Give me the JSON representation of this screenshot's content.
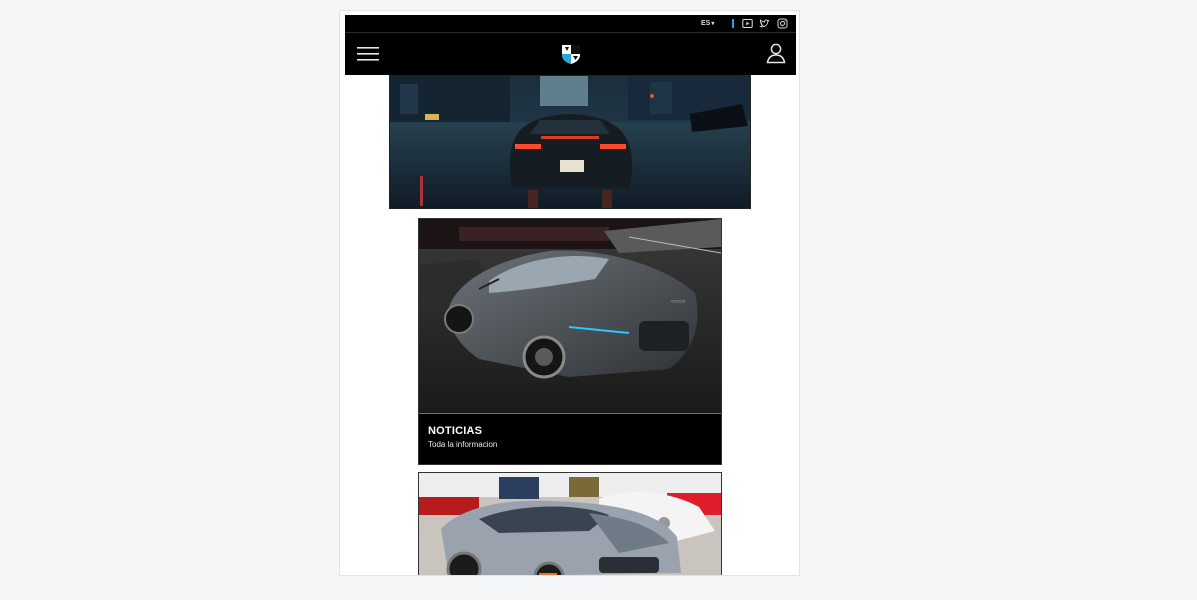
{
  "topbar": {
    "language": "ES",
    "language_caret": "▾",
    "icons": [
      "youtube-icon",
      "twitter-icon",
      "instagram-icon"
    ]
  },
  "navbar": {
    "icons": [
      "menu-icon",
      "brand-logo-icon",
      "user-icon"
    ]
  },
  "cards": [
    {
      "title": "NOTICIAS",
      "subtitle": "Toda la informacion"
    }
  ],
  "colors": {
    "header_bg": "#000000",
    "accent": "#2aa6d9",
    "caption_border": "#1f8fa0",
    "page_bg": "#f5f6f7"
  }
}
